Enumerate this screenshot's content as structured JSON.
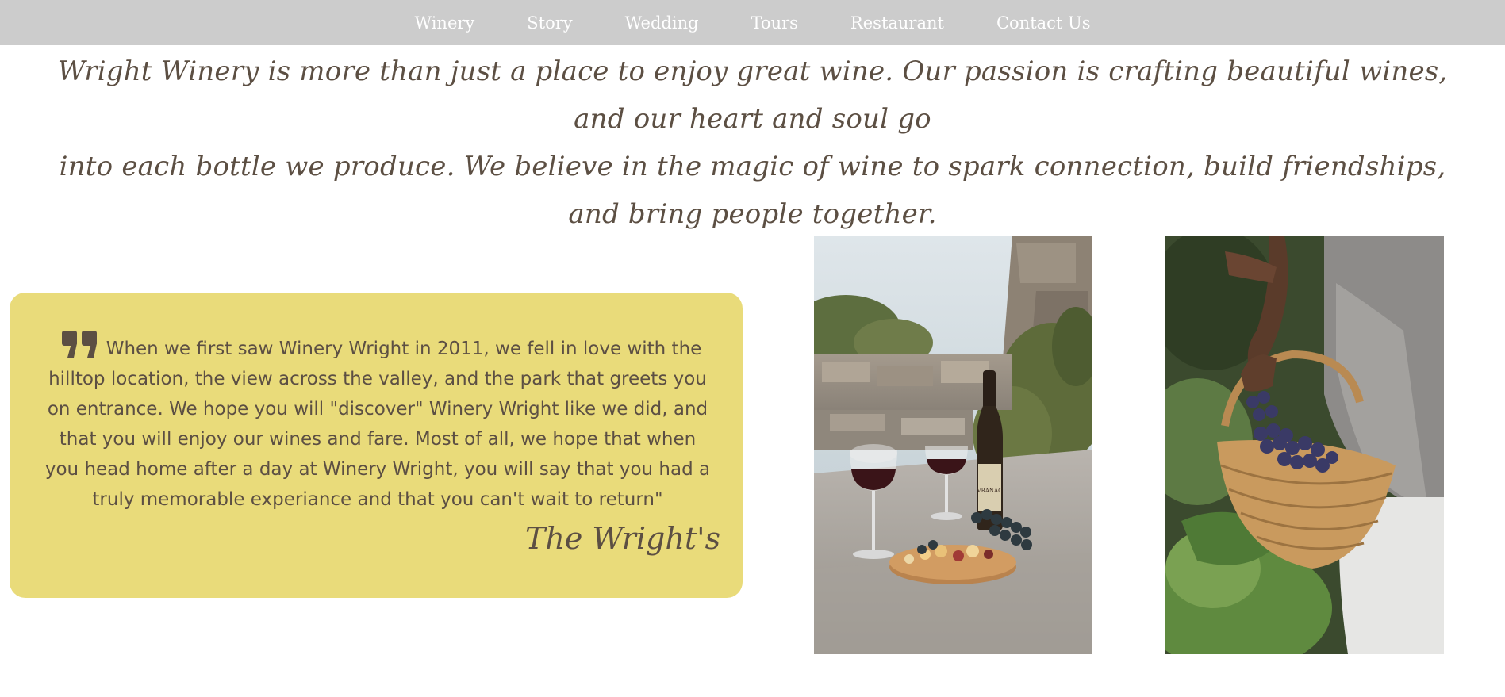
{
  "nav": {
    "items": [
      "Winery",
      "Story",
      "Wedding",
      "Tours",
      "Restaurant",
      "Contact Us"
    ]
  },
  "tagline": {
    "line1": "Wright Winery is more than just a place to enjoy great wine. Our passion is crafting beautiful wines, and our heart and soul go",
    "line2": "into each bottle we produce. We believe in the magic of wine to spark connection, build friendships, and bring people together."
  },
  "testimonial": {
    "quote": "When we first saw Winery Wright in 2011, we fell in love with the hilltop location, the view across the valley, and the park that greets you on entrance. We hope you will \"discover\" Winery Wright like we did, and that you will enjoy our wines and fare. Most of all, we hope that when you head home after a day at Winery Wright, you will say that you had a truly memorable experiance and that you can't wait to return\"",
    "signature": "The Wright's",
    "icon": "quote-icon",
    "background_color": "#e9db7a",
    "text_color": "#5c4f43"
  },
  "photos": {
    "wine": {
      "icon": "wine-picnic-photo",
      "bottle_label": "VRANAC"
    },
    "basket": {
      "icon": "grape-basket-photo"
    }
  },
  "colors": {
    "nav_bg": "#cccccc",
    "nav_text": "#ffffff",
    "body_text": "#5c4f43"
  }
}
